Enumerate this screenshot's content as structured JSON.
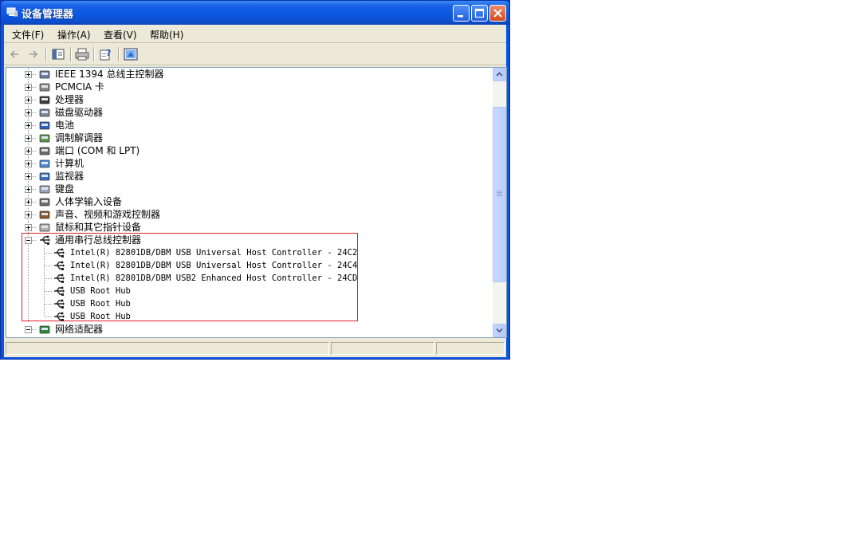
{
  "window": {
    "title": "设备管理器"
  },
  "menu": [
    {
      "label": "文件(F)"
    },
    {
      "label": "操作(A)"
    },
    {
      "label": "查看(V)"
    },
    {
      "label": "帮助(H)"
    }
  ],
  "toolbar": {
    "back": "back-arrow-icon",
    "forward": "forward-arrow-icon",
    "show_hide_tree": "console-tree-icon",
    "print": "printer-icon",
    "properties": "properties-help-icon",
    "update": "update-driver-icon"
  },
  "tree": {
    "categories": [
      {
        "label": "IEEE 1394 总线主控制器",
        "icon": "ieee1394-icon",
        "expanded": false
      },
      {
        "label": "PCMCIA 卡",
        "icon": "pcmcia-card-icon",
        "expanded": false
      },
      {
        "label": "处理器",
        "icon": "processor-icon",
        "expanded": false
      },
      {
        "label": "磁盘驱动器",
        "icon": "disk-drive-icon",
        "expanded": false
      },
      {
        "label": "电池",
        "icon": "battery-icon",
        "expanded": false
      },
      {
        "label": "调制解调器",
        "icon": "modem-icon",
        "expanded": false
      },
      {
        "label": "端口 (COM 和 LPT)",
        "icon": "port-icon",
        "expanded": false
      },
      {
        "label": "计算机",
        "icon": "computer-icon",
        "expanded": false
      },
      {
        "label": "监视器",
        "icon": "monitor-icon",
        "expanded": false
      },
      {
        "label": "键盘",
        "icon": "keyboard-icon",
        "expanded": false
      },
      {
        "label": "人体学输入设备",
        "icon": "hid-icon",
        "expanded": false
      },
      {
        "label": "声音、视频和游戏控制器",
        "icon": "sound-icon",
        "expanded": false
      },
      {
        "label": "鼠标和其它指针设备",
        "icon": "mouse-icon",
        "expanded": false
      },
      {
        "label": "通用串行总线控制器",
        "icon": "usb-icon",
        "expanded": true
      },
      {
        "label": "网络适配器",
        "icon": "network-adapter-icon",
        "expanded": true
      }
    ],
    "usb_children": [
      {
        "label": "Intel(R) 82801DB/DBM USB Universal Host Controller - 24C2"
      },
      {
        "label": "Intel(R) 82801DB/DBM USB Universal Host Controller - 24C4"
      },
      {
        "label": "Intel(R) 82801DB/DBM USB2 Enhanced Host Controller - 24CD"
      },
      {
        "label": "USB Root Hub"
      },
      {
        "label": "USB Root Hub"
      },
      {
        "label": "USB Root Hub"
      }
    ]
  },
  "colors": {
    "titlebar": "#0a58e0",
    "highlight_border": "#e0202a",
    "chrome": "#ece9d8"
  }
}
